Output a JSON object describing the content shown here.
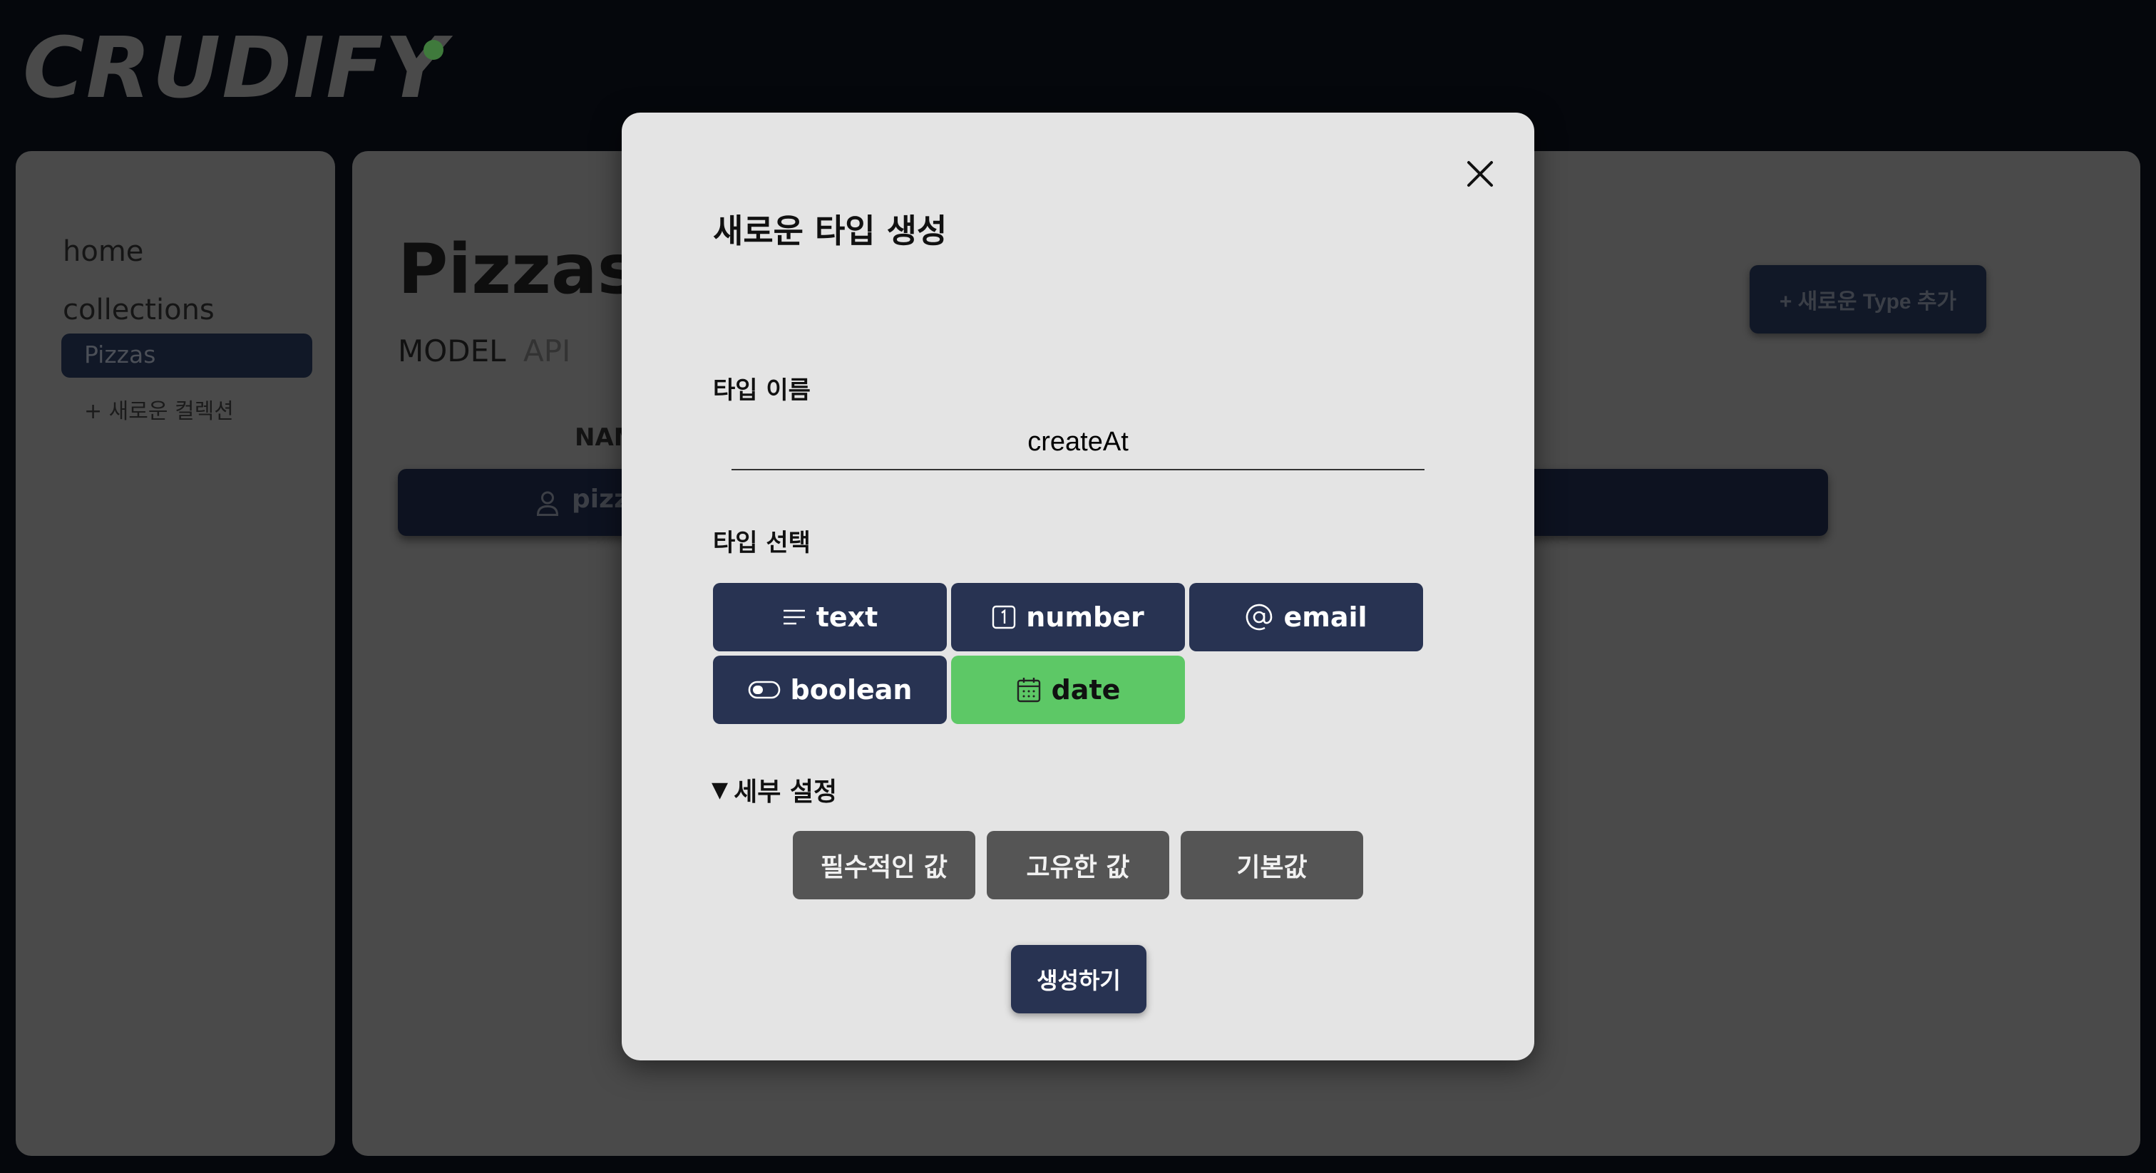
{
  "app": {
    "logo": "CRUDIFY"
  },
  "sidebar": {
    "links": [
      {
        "label": "home"
      },
      {
        "label": "collections"
      }
    ],
    "selected_collection": "Pizzas",
    "new_collection": "+ 새로운 컬렉션"
  },
  "main": {
    "title": "Pizzas",
    "tabs": [
      {
        "label": "MODEL"
      },
      {
        "label": "API"
      }
    ],
    "add_type_button": "+ 새로운 Type 추가",
    "column_header": "NAM",
    "row_text": "pizz"
  },
  "modal": {
    "title": "새로운 타입 생성",
    "name_label": "타입 이름",
    "name_value": "createAt",
    "type_label": "타입 선택",
    "types": [
      {
        "label": "text",
        "icon": "lines-icon"
      },
      {
        "label": "number",
        "icon": "number-box-icon"
      },
      {
        "label": "email",
        "icon": "at-icon"
      },
      {
        "label": "boolean",
        "icon": "toggle-icon"
      },
      {
        "label": "date",
        "icon": "calendar-icon",
        "selected": true
      }
    ],
    "details_label": "세부 설정",
    "details_options": [
      {
        "label": "필수적인 값"
      },
      {
        "label": "고유한 값"
      },
      {
        "label": "기본값"
      }
    ],
    "create_button": "생성하기"
  },
  "colors": {
    "accent_selected": "#5dc866",
    "button_navy": "#283352",
    "option_gray": "#555555"
  }
}
